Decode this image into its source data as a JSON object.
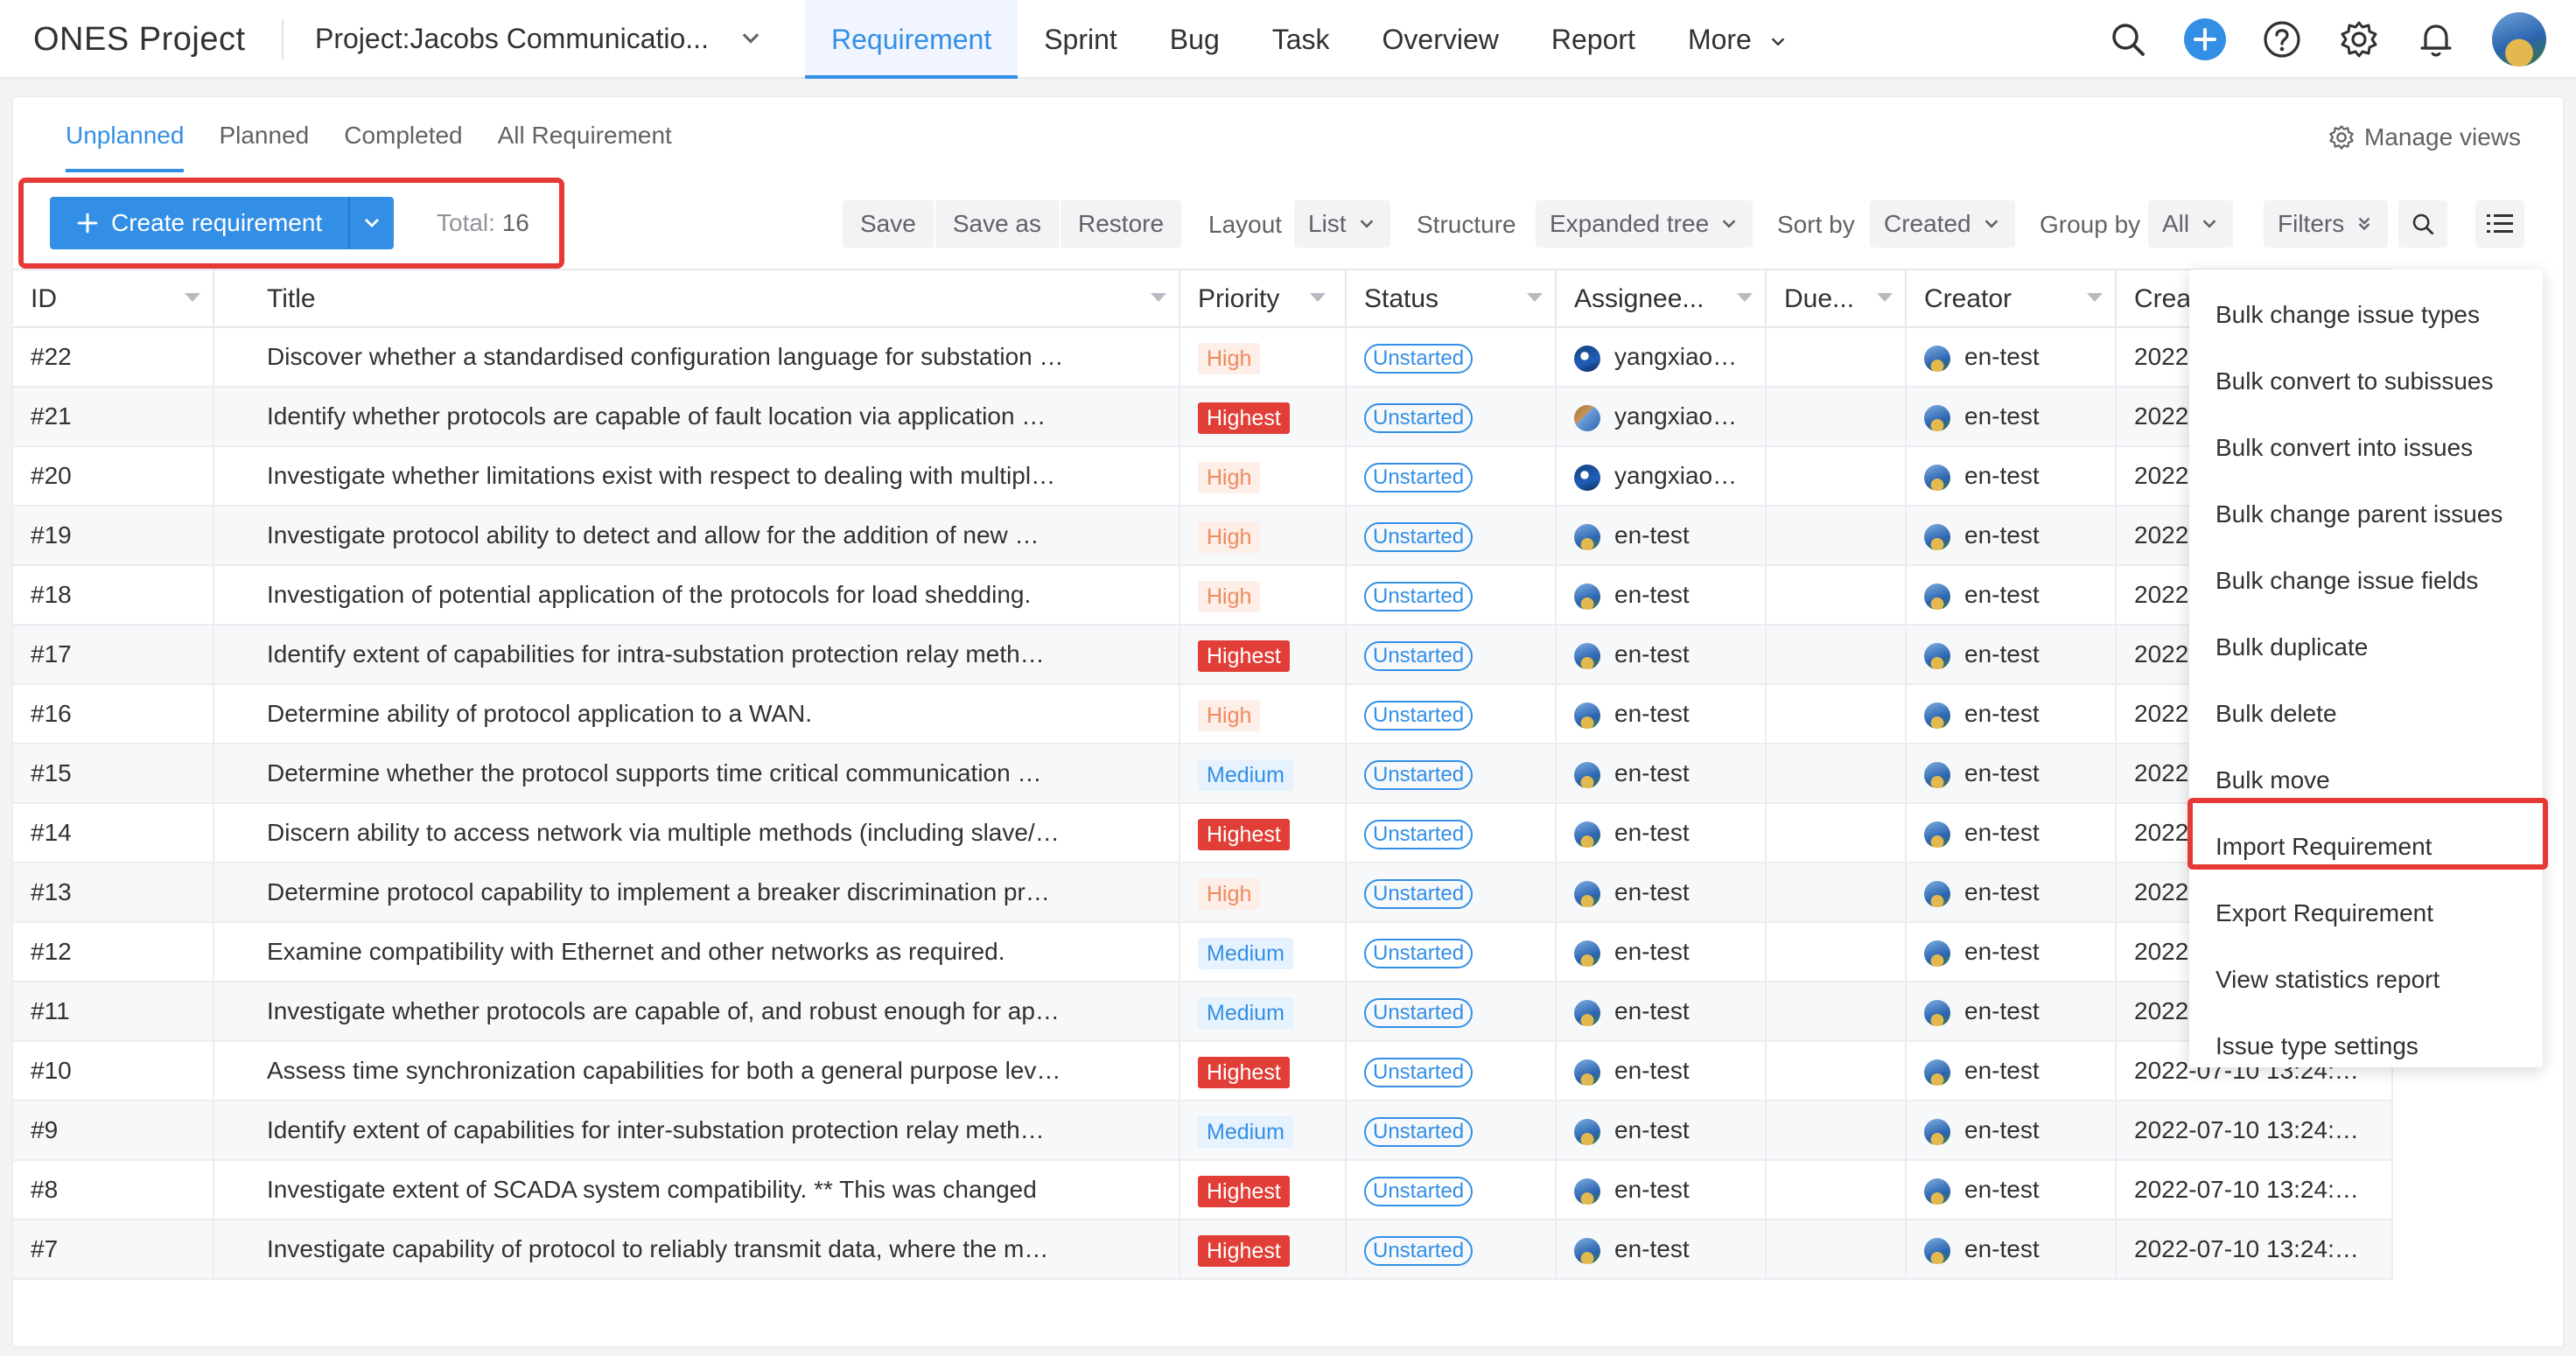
{
  "topnav": {
    "brand": "ONES Project",
    "project": "Project:Jacobs Communicatio...",
    "tabs": [
      "Requirement",
      "Sprint",
      "Bug",
      "Task",
      "Overview",
      "Report",
      "More"
    ],
    "active_tab": "Requirement",
    "icons": [
      "search-icon",
      "plus-icon",
      "help-icon",
      "gear-icon",
      "bell-icon",
      "avatar"
    ]
  },
  "subtabs": [
    "Unplanned",
    "Planned",
    "Completed",
    "All Requirement"
  ],
  "manage_views": "Manage views",
  "toolbar": {
    "create_label": "Create requirement",
    "total_label": "Total:",
    "total_value": "16",
    "save": "Save",
    "save_as": "Save as",
    "restore": "Restore",
    "layout_label": "Layout",
    "layout_value": "List",
    "structure_label": "Structure",
    "structure_value": "Expanded tree",
    "sort_label": "Sort by",
    "sort_value": "Created",
    "group_label": "Group by",
    "group_value": "All",
    "filters": "Filters"
  },
  "table": {
    "columns": [
      "ID",
      "Title",
      "Priority",
      "Status",
      "Assignee...",
      "Due...",
      "Creator",
      "Creat"
    ],
    "rows": [
      {
        "id": "#22",
        "title": "Discover whether a standardised configuration language for substation …",
        "priority": "High",
        "status": "Unstarted",
        "assignee": "yangxiao…",
        "creator": "en-test",
        "created": "2022-"
      },
      {
        "id": "#21",
        "title": "Identify whether protocols are capable of fault location via application …",
        "priority": "Highest",
        "status": "Unstarted",
        "assignee": "yangxiao…",
        "creator": "en-test",
        "created": "2022-"
      },
      {
        "id": "#20",
        "title": "Investigate whether limitations exist with respect to dealing with multipl…",
        "priority": "High",
        "status": "Unstarted",
        "assignee": "yangxiao…",
        "creator": "en-test",
        "created": "2022-"
      },
      {
        "id": "#19",
        "title": "Investigate protocol ability to detect and allow for the addition of new …",
        "priority": "High",
        "status": "Unstarted",
        "assignee": "en-test",
        "creator": "en-test",
        "created": "2022-"
      },
      {
        "id": "#18",
        "title": "Investigation of potential application of the protocols for load shedding.",
        "priority": "High",
        "status": "Unstarted",
        "assignee": "en-test",
        "creator": "en-test",
        "created": "2022-"
      },
      {
        "id": "#17",
        "title": "Identify extent of capabilities for intra-substation protection relay meth…",
        "priority": "Highest",
        "status": "Unstarted",
        "assignee": "en-test",
        "creator": "en-test",
        "created": "2022-"
      },
      {
        "id": "#16",
        "title": "Determine ability of protocol application to a WAN.",
        "priority": "High",
        "status": "Unstarted",
        "assignee": "en-test",
        "creator": "en-test",
        "created": "2022-"
      },
      {
        "id": "#15",
        "title": "Determine whether the protocol supports time critical communication …",
        "priority": "Medium",
        "status": "Unstarted",
        "assignee": "en-test",
        "creator": "en-test",
        "created": "2022-"
      },
      {
        "id": "#14",
        "title": "Discern ability to access network via multiple methods (including slave/…",
        "priority": "Highest",
        "status": "Unstarted",
        "assignee": "en-test",
        "creator": "en-test",
        "created": "2022-"
      },
      {
        "id": "#13",
        "title": "Determine protocol capability to implement a breaker discrimination pr…",
        "priority": "High",
        "status": "Unstarted",
        "assignee": "en-test",
        "creator": "en-test",
        "created": "2022-"
      },
      {
        "id": "#12",
        "title": "Examine compatibility with Ethernet and other networks as required.",
        "priority": "Medium",
        "status": "Unstarted",
        "assignee": "en-test",
        "creator": "en-test",
        "created": "2022-"
      },
      {
        "id": "#11",
        "title": "Investigate whether protocols are capable of, and robust enough for ap…",
        "priority": "Medium",
        "status": "Unstarted",
        "assignee": "en-test",
        "creator": "en-test",
        "created": "2022-"
      },
      {
        "id": "#10",
        "title": "Assess time synchronization capabilities for both a general purpose lev…",
        "priority": "Highest",
        "status": "Unstarted",
        "assignee": "en-test",
        "creator": "en-test",
        "created": "2022-07-10 13:24:…"
      },
      {
        "id": "#9",
        "title": "Identify extent of capabilities for inter-substation protection relay meth…",
        "priority": "Medium",
        "status": "Unstarted",
        "assignee": "en-test",
        "creator": "en-test",
        "created": "2022-07-10 13:24:…"
      },
      {
        "id": "#8",
        "title": "Investigate extent of SCADA system compatibility. ** This was changed",
        "priority": "Highest",
        "status": "Unstarted",
        "assignee": "en-test",
        "creator": "en-test",
        "created": "2022-07-10 13:24:…"
      },
      {
        "id": "#7",
        "title": "Investigate capability of protocol to reliably transmit data, where the m…",
        "priority": "Highest",
        "status": "Unstarted",
        "assignee": "en-test",
        "creator": "en-test",
        "created": "2022-07-10 13:24:…"
      }
    ]
  },
  "menu": {
    "items": [
      "Bulk change issue types",
      "Bulk convert to subissues",
      "Bulk convert into issues",
      "Bulk change parent issues",
      "Bulk change issue fields",
      "Bulk duplicate",
      "Bulk delete",
      "Bulk move",
      "Import Requirement",
      "Export Requirement",
      "View statistics report",
      "Issue type settings"
    ],
    "highlighted": "Import Requirement"
  },
  "colors": {
    "accent": "#338fe5",
    "highest": "#e03e36",
    "high": "#f08a5d",
    "highlight_box": "#e53935"
  }
}
